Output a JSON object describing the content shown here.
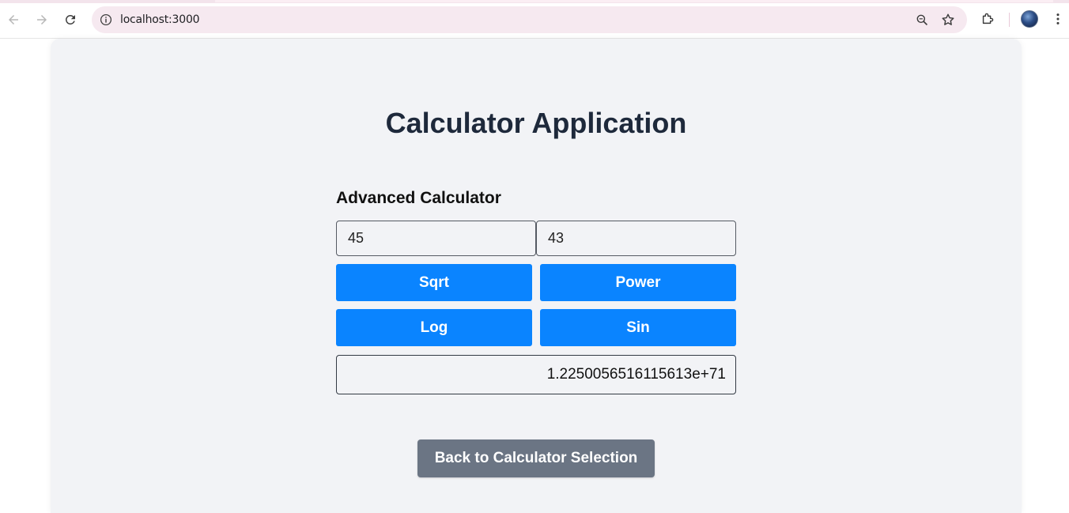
{
  "browser": {
    "url": "localhost:3000",
    "icons": {
      "back": "arrow-left-icon",
      "forward": "arrow-right-icon",
      "reload": "reload-icon",
      "site_info": "info-icon",
      "zoom": "zoom-icon",
      "bookmark": "star-icon",
      "extensions": "puzzle-icon",
      "profile": "avatar",
      "menu": "kebab-menu-icon"
    }
  },
  "page": {
    "title": "Calculator Application"
  },
  "calculator": {
    "heading": "Advanced Calculator",
    "input_a": "45",
    "input_b": "43",
    "buttons": {
      "sqrt": "Sqrt",
      "power": "Power",
      "log": "Log",
      "sin": "Sin"
    },
    "result": "1.2250056516115613e+71"
  },
  "footer": {
    "back_label": "Back to Calculator Selection"
  },
  "colors": {
    "primary": "#0a84ff",
    "secondary": "#6b7584",
    "title": "#1e293b",
    "panel": "#f2f3f6"
  }
}
